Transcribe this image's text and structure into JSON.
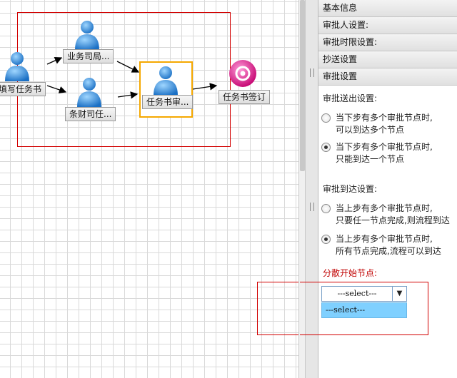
{
  "canvas": {
    "nodes": [
      {
        "id": "fill",
        "label": "填写任务书"
      },
      {
        "id": "bizdept",
        "label": "业务司局..."
      },
      {
        "id": "finance",
        "label": "条财司任..."
      },
      {
        "id": "review",
        "label": "任务书审..."
      },
      {
        "id": "sign",
        "label": "任务书签订"
      }
    ]
  },
  "panel": {
    "accordion": [
      "基本信息",
      "审批人设置:",
      "审批时限设置:",
      "抄送设置",
      "审批设置"
    ],
    "send_title": "审批送出设置:",
    "send_options": [
      {
        "line1": "当下步有多个审批节点时,",
        "line2": "可以到达多个节点",
        "checked": false
      },
      {
        "line1": "当下步有多个审批节点时,",
        "line2": "只能到达一个节点",
        "checked": true
      }
    ],
    "arrive_title": "审批到达设置:",
    "arrive_options": [
      {
        "line1": "当上步有多个审批节点时,",
        "line2": "只要任一节点完成,则流程到达",
        "checked": false
      },
      {
        "line1": "当上步有多个审批节点时,",
        "line2": "所有节点完成,流程可以到达",
        "checked": true
      }
    ],
    "split_title": "分散开始节点:",
    "select_value": "---select---",
    "dropdown_option": "---select---"
  },
  "colors": {
    "selection": "#d20000",
    "highlight": "#f5a800",
    "dropdown": "#7fd0ff",
    "accent_red": "#c00000"
  }
}
